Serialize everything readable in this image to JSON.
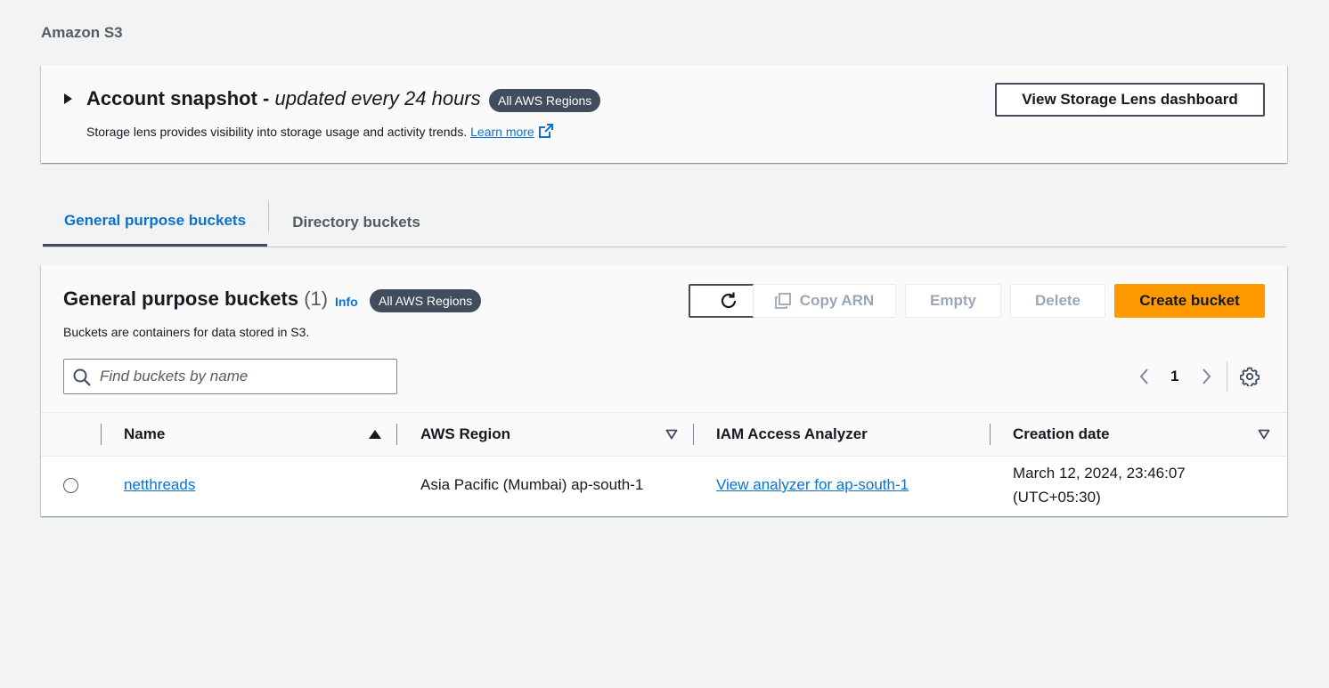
{
  "breadcrumb": "Amazon S3",
  "snapshot": {
    "title": "Account snapshot -",
    "title_suffix": "updated every 24 hours",
    "badge": "All AWS Regions",
    "description": "Storage lens provides visibility into storage usage and activity trends.",
    "learn_more": "Learn more",
    "dashboard_button": "View Storage Lens dashboard"
  },
  "tabs": [
    {
      "label": "General purpose buckets",
      "active": true
    },
    {
      "label": "Directory buckets",
      "active": false
    }
  ],
  "panel": {
    "title": "General purpose buckets",
    "count": "(1)",
    "info": "Info",
    "badge": "All AWS Regions",
    "description": "Buckets are containers for data stored in S3.",
    "buttons": {
      "copy_arn": "Copy ARN",
      "empty": "Empty",
      "delete": "Delete",
      "create": "Create bucket"
    },
    "search_placeholder": "Find buckets by name",
    "page": "1"
  },
  "table": {
    "columns": [
      "Name",
      "AWS Region",
      "IAM Access Analyzer",
      "Creation date"
    ],
    "rows": [
      {
        "name": "netthreads",
        "region": "Asia Pacific (Mumbai) ap-south-1",
        "analyzer": "View analyzer for ap-south-1",
        "date_line1": "March 12, 2024, 23:46:07",
        "date_line2": "(UTC+05:30)"
      }
    ]
  },
  "colors": {
    "accent": "#0972d3",
    "primary_button": "#ff9900",
    "badge_bg": "#414d5c",
    "background": "#f2f3f3"
  }
}
